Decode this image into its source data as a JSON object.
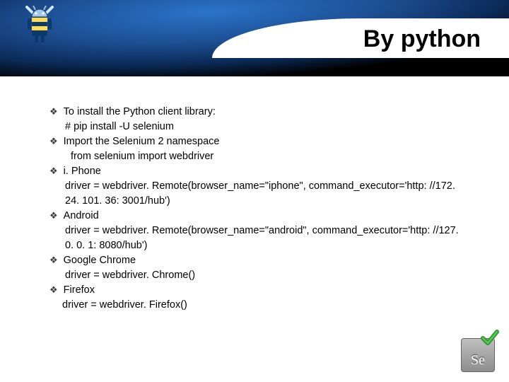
{
  "header": {
    "title": "By python"
  },
  "bullets": [
    {
      "head": "To install the Python client library:",
      "subs": [
        "# pip install -U selenium"
      ]
    },
    {
      "head": "Import the Selenium 2 namespace",
      "subs": [
        "from selenium import webdriver"
      ]
    },
    {
      "head": "i. Phone",
      "subs": [
        "driver = webdriver. Remote(browser_name=\"iphone\", command_executor='http: //172. 24. 101. 36: 3001/hub')"
      ]
    },
    {
      "head": "Android",
      "subs": [
        "driver = webdriver. Remote(browser_name=\"android\", command_executor='http: //127. 0. 0. 1: 8080/hub')"
      ]
    },
    {
      "head": "Google Chrome",
      "subs": [
        "driver = webdriver. Chrome()"
      ]
    },
    {
      "head": "Firefox",
      "subs": [
        "driver = webdriver. Firefox()"
      ]
    }
  ],
  "badge": {
    "label": "Se"
  }
}
